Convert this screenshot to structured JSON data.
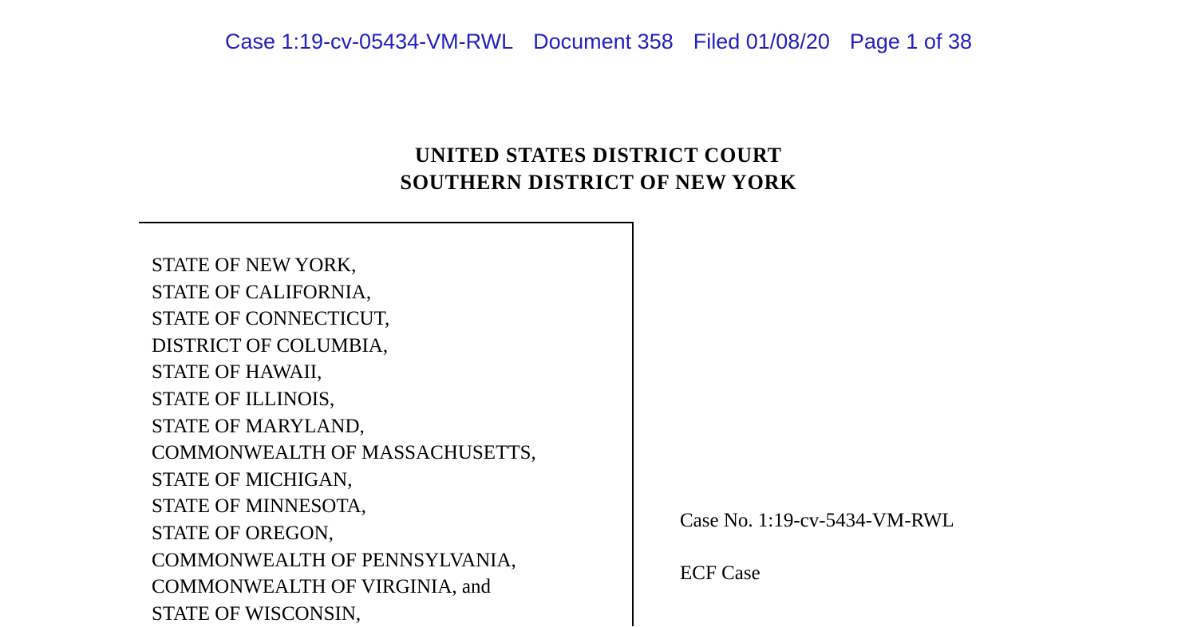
{
  "ecf_header": {
    "segments": [
      "Case 1:19-cv-05434-VM-RWL",
      "Document 358",
      "Filed 01/08/20",
      "Page 1 of 38"
    ],
    "color": "#2020c0"
  },
  "court_title": {
    "line1": "UNITED STATES DISTRICT COURT",
    "line2": "SOUTHERN DISTRICT OF NEW YORK"
  },
  "caption": {
    "plaintiffs": [
      "STATE OF NEW YORK,",
      "STATE OF CALIFORNIA,",
      "STATE OF CONNECTICUT,",
      "DISTRICT OF COLUMBIA,",
      "STATE OF HAWAII,",
      "STATE OF ILLINOIS,",
      "STATE OF MARYLAND,",
      "COMMONWEALTH OF MASSACHUSETTS,",
      "STATE OF MICHIGAN,",
      "STATE OF MINNESOTA,",
      "STATE OF OREGON,",
      "COMMONWEALTH OF PENNSYLVANIA,",
      "COMMONWEALTH OF VIRGINIA, and",
      "STATE OF WISCONSIN,"
    ]
  },
  "case_info": {
    "case_number": "Case No. 1:19-cv-5434-VM-RWL",
    "ecf_designation": "ECF Case"
  }
}
